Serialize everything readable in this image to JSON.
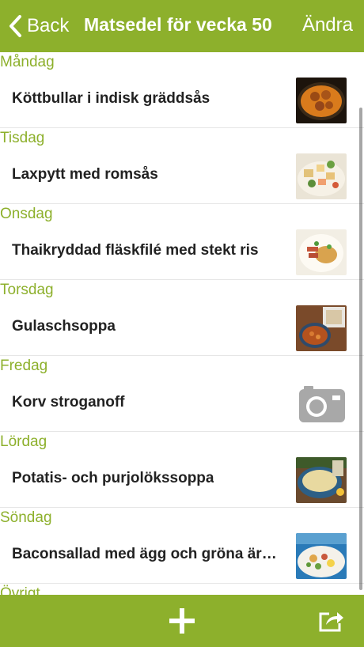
{
  "nav": {
    "back_label": "Back",
    "title": "Matsedel för vecka 50",
    "edit_label": "Ändra"
  },
  "days": [
    {
      "day": "Måndag",
      "dish": "Köttbullar i indisk gräddsås",
      "thumb": "meatballs-curry-photo"
    },
    {
      "day": "Tisdag",
      "dish": "Laxpytt med romsås",
      "thumb": "salmon-hash-photo"
    },
    {
      "day": "Onsdag",
      "dish": "Thaikryddad fläskfilé med stekt ris",
      "thumb": "thai-pork-rice-photo"
    },
    {
      "day": "Torsdag",
      "dish": "Gulaschsoppa",
      "thumb": "goulash-soup-photo"
    },
    {
      "day": "Fredag",
      "dish": "Korv stroganoff",
      "thumb": "camera-placeholder-icon"
    },
    {
      "day": "Lördag",
      "dish": "Potatis- och purjolökssoppa",
      "thumb": "potato-leek-soup-photo"
    },
    {
      "day": "Söndag",
      "dish": "Baconsallad med ägg och gröna är…",
      "thumb": "bacon-salad-photo"
    },
    {
      "day": "Övrigt",
      "dish": "",
      "thumb": ""
    }
  ],
  "colors": {
    "accent": "#8db02c",
    "text": "#222222",
    "separator": "#e6e6e6"
  },
  "toolbar": {
    "add_icon": "plus-icon",
    "share_icon": "share-icon"
  }
}
